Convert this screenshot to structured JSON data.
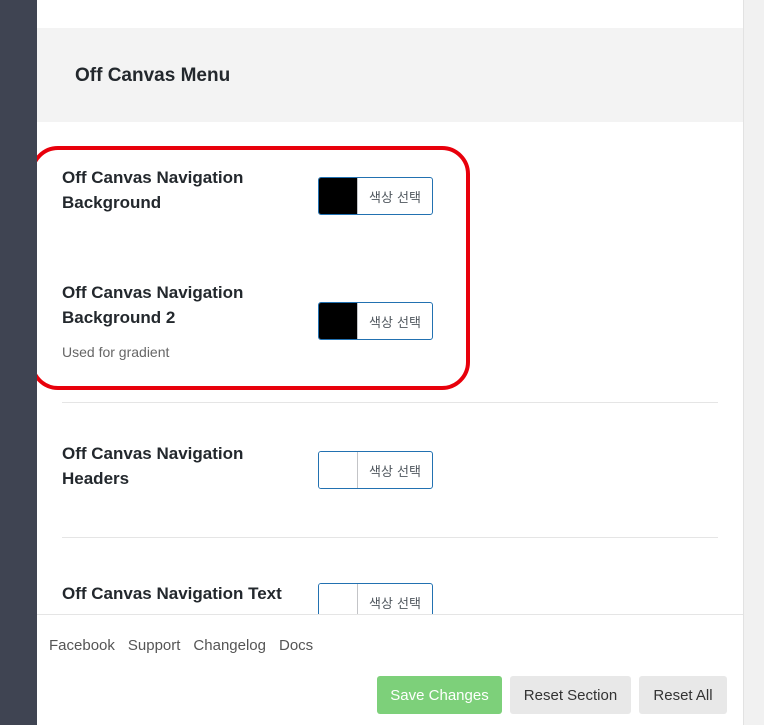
{
  "section": {
    "title": "Off Canvas Menu"
  },
  "options": [
    {
      "label": "Off Canvas Navigation Background",
      "description": "",
      "picker_text": "색상 선택",
      "swatch_color": "#000000"
    },
    {
      "label": "Off Canvas Navigation Background 2",
      "description": "Used for gradient",
      "picker_text": "색상 선택",
      "swatch_color": "#000000"
    },
    {
      "label": "Off Canvas Navigation Headers",
      "description": "",
      "picker_text": "색상 선택",
      "swatch_color": "#ffffff"
    },
    {
      "label": "Off Canvas Navigation Text",
      "description": "",
      "picker_text": "색상 선택",
      "swatch_color": "#ffffff"
    }
  ],
  "footer": {
    "links": [
      "Facebook",
      "Support",
      "Changelog",
      "Docs"
    ],
    "save_label": "Save Changes",
    "reset_section_label": "Reset Section",
    "reset_all_label": "Reset All"
  },
  "colors": {
    "sidebar": "#3f4452",
    "save_button": "#7dd07a",
    "highlight": "#e8000b",
    "picker_border": "#2271b1"
  }
}
